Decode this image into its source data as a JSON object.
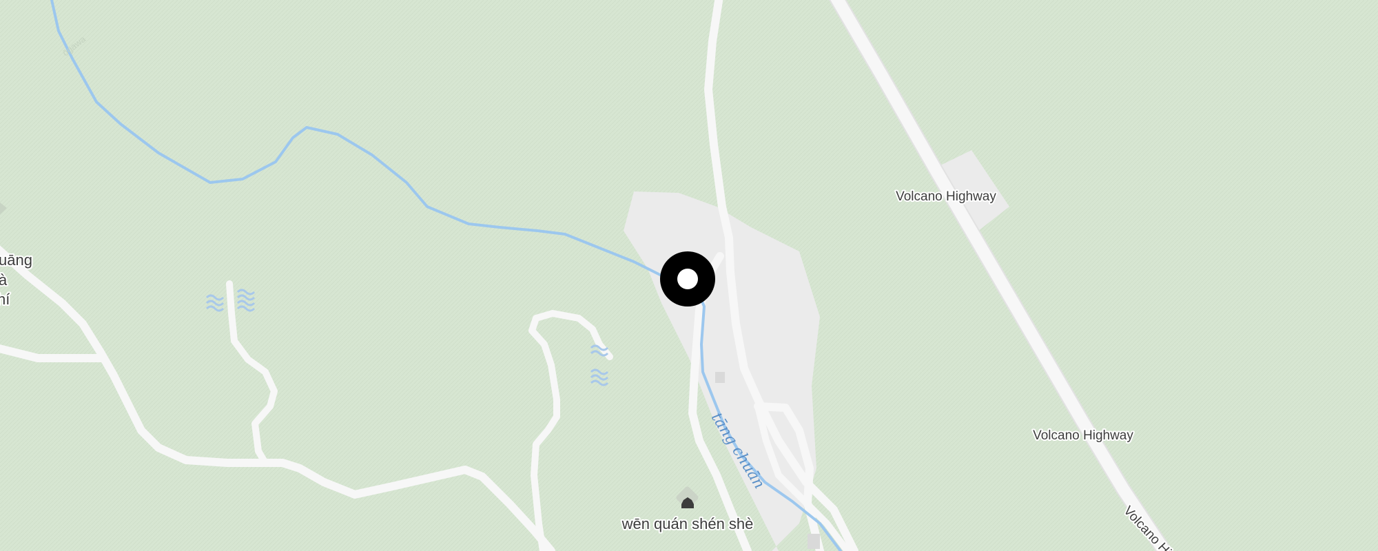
{
  "map": {
    "colors": {
      "land": "#d7e6d2",
      "road": "#f7f7f7",
      "developed_area": "#ececec",
      "river": "#9cc7ee",
      "label_text": "#3c3c3c",
      "water_label": "#5a8fc7",
      "marker_ring": "#000000",
      "marker_center": "#ffffff"
    },
    "labels": {
      "highway_upper": "Volcano Highway",
      "highway_lower": "Volcano Highway",
      "highway_rotated": "Volcano Hi",
      "river": "tāng chuān",
      "poi": "wēn quán shén shè",
      "left_partial_1": "uāng",
      "left_partial_2": "à",
      "left_partial_3": "hí",
      "faint_river_label": "ōgawa"
    },
    "icons": {
      "poi": "shrine-icon",
      "marker": "location-marker-icon",
      "wetland": "wetland-icon"
    }
  }
}
